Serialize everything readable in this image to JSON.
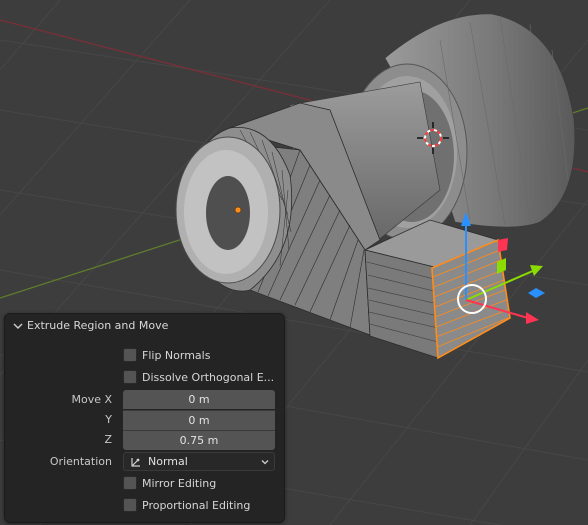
{
  "colors": {
    "viewport_bg": "#3d3d3d",
    "mesh_gray": "#8f8f8f",
    "selection_orange": "#ff8c1a",
    "gizmo_x": "#ff3352",
    "gizmo_y": "#8bdc00",
    "gizmo_z": "#2890ff"
  },
  "viewport": {
    "cursor_icon": "3d-cursor-icon",
    "gizmo_icon": "move-gizmo-icon"
  },
  "operator_panel": {
    "title": "Extrude Region and Move",
    "collapse_icon": "chevron-down-icon",
    "flip_normals": {
      "label": "Flip Normals",
      "checked": false
    },
    "dissolve_orthogonal": {
      "label": "Dissolve Orthogonal E...",
      "checked": false
    },
    "move": {
      "x_label": "Move X",
      "x_value": "0 m",
      "y_label": "Y",
      "y_value": "0 m",
      "z_label": "Z",
      "z_value": "0.75 m"
    },
    "orientation": {
      "label": "Orientation",
      "value": "Normal",
      "icon": "orientation-normal-icon"
    },
    "mirror_editing": {
      "label": "Mirror Editing",
      "checked": false
    },
    "proportional_editing": {
      "label": "Proportional Editing",
      "checked": false
    }
  }
}
